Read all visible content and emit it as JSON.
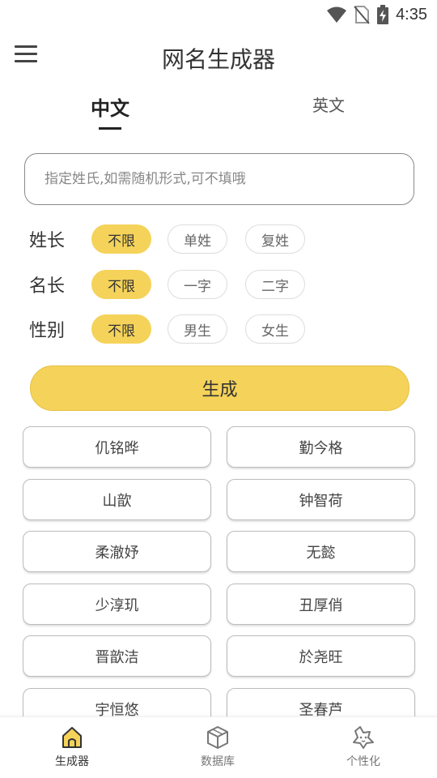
{
  "status": {
    "time": "4:35"
  },
  "app": {
    "title": "网名生成器"
  },
  "tabs": [
    {
      "label": "中文",
      "active": true
    },
    {
      "label": "英文",
      "active": false
    }
  ],
  "search": {
    "placeholder": "指定姓氏,如需随机形式,可不填哦",
    "value": ""
  },
  "options": [
    {
      "label": "姓长",
      "choices": [
        "不限",
        "单姓",
        "复姓"
      ],
      "selected": "不限"
    },
    {
      "label": "名长",
      "choices": [
        "不限",
        "一字",
        "二字"
      ],
      "selected": "不限"
    },
    {
      "label": "性别",
      "choices": [
        "不限",
        "男生",
        "女生"
      ],
      "selected": "不限"
    }
  ],
  "generate_label": "生成",
  "results": [
    "仉铭晔",
    "勤今格",
    "山歆",
    "钟智荷",
    "柔澈妤",
    "无懿",
    "少淳玑",
    "丑厚俏",
    "晋歆洁",
    "於尧旺",
    "宇恒悠",
    "圣春芦"
  ],
  "bottom_nav": [
    {
      "label": "生成器",
      "icon": "home-icon",
      "active": true
    },
    {
      "label": "数据库",
      "icon": "cube-icon",
      "active": false
    },
    {
      "label": "个性化",
      "icon": "star-face-icon",
      "active": false
    }
  ],
  "colors": {
    "accent": "#f5d35a",
    "text": "#333333",
    "border": "#bbbbbb"
  }
}
